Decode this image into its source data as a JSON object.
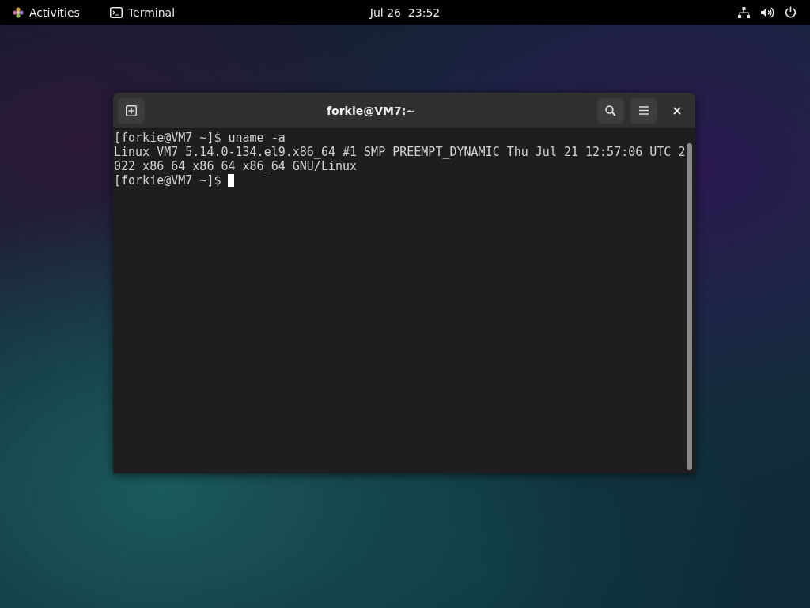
{
  "top_bar": {
    "activities": "Activities",
    "app_name": "Terminal",
    "clock": "Jul 26  23:52"
  },
  "window": {
    "title": "forkie@VM7:~",
    "lines": [
      "[forkie@VM7 ~]$ uname -a",
      "Linux VM7 5.14.0-134.el9.x86_64 #1 SMP PREEMPT_DYNAMIC Thu Jul 21 12:57:06 UTC 2",
      "022 x86_64 x86_64 x86_64 GNU/Linux",
      "[forkie@VM7 ~]$"
    ]
  }
}
